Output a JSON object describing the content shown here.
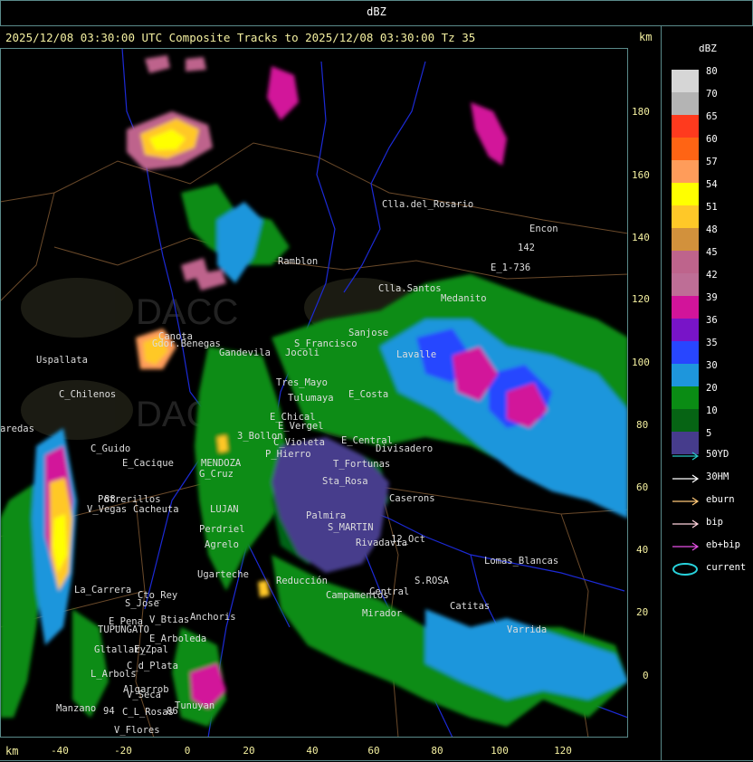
{
  "header": {
    "title": "dBZ",
    "subtitle": "2025/12/08 03:30:00 UTC Composite Tracks to 2025/12/08 03:30:00 Tz 35",
    "unit_label": "km"
  },
  "axes": {
    "x_ticks": [
      "-40",
      "-20",
      "0",
      "20",
      "40",
      "60",
      "80",
      "100",
      "120"
    ],
    "y_ticks": [
      "180",
      "160",
      "140",
      "120",
      "100",
      "80",
      "60",
      "40",
      "20",
      "0"
    ],
    "x_unit": "km",
    "y_unit": "km"
  },
  "legend": {
    "title": "dBZ",
    "levels": [
      {
        "value": "80",
        "color": "#d6d6d6"
      },
      {
        "value": "70",
        "color": "#b4b4b4"
      },
      {
        "value": "65",
        "color": "#ff3a1e"
      },
      {
        "value": "60",
        "color": "#ff6414"
      },
      {
        "value": "57",
        "color": "#ff9c5a"
      },
      {
        "value": "54",
        "color": "#ffff00"
      },
      {
        "value": "51",
        "color": "#ffc828"
      },
      {
        "value": "48",
        "color": "#d2913c"
      },
      {
        "value": "45",
        "color": "#be648c"
      },
      {
        "value": "42",
        "color": "#be6e96"
      },
      {
        "value": "39",
        "color": "#d2149a"
      },
      {
        "value": "36",
        "color": "#7814c8"
      },
      {
        "value": "35",
        "color": "#2846ff"
      },
      {
        "value": "30",
        "color": "#1e96dc"
      },
      {
        "value": "20",
        "color": "#0a8c14"
      },
      {
        "value": "10",
        "color": "#066414"
      },
      {
        "value": "5",
        "color": "#463c8c"
      }
    ],
    "tracks": [
      {
        "label": "50YD",
        "color": "#28c8c8"
      },
      {
        "label": "30HM",
        "color": "#ffffff"
      },
      {
        "label": "eburn",
        "color": "#ffc878"
      },
      {
        "label": "bip",
        "color": "#ffd2dc"
      },
      {
        "label": "eb+bip",
        "color": "#e650e6"
      },
      {
        "label": "current",
        "color": "#28d2dc"
      }
    ]
  },
  "places": [
    {
      "name": "Clla.del_Rosario"
    },
    {
      "name": "Encon"
    },
    {
      "name": "142"
    },
    {
      "name": "E_1-736"
    },
    {
      "name": "Ramblon"
    },
    {
      "name": "Clla.Santos"
    },
    {
      "name": "Medanito"
    },
    {
      "name": "Uspallata"
    },
    {
      "name": "Canota"
    },
    {
      "name": "Gdor.Benegas"
    },
    {
      "name": "Gandevila"
    },
    {
      "name": "S_Francisco"
    },
    {
      "name": "Jocoli"
    },
    {
      "name": "Sanjose"
    },
    {
      "name": "Lavalle"
    },
    {
      "name": "C_Chilenos"
    },
    {
      "name": "Tres_Mayo"
    },
    {
      "name": "Tulumaya"
    },
    {
      "name": "E_Costa"
    },
    {
      "name": "aredas"
    },
    {
      "name": "E_Chical"
    },
    {
      "name": "E_Vergel"
    },
    {
      "name": "3_Bollon"
    },
    {
      "name": "C_Violeta"
    },
    {
      "name": "E_Central"
    },
    {
      "name": "Divisadero"
    },
    {
      "name": "C_Guido"
    },
    {
      "name": "P_Hierro"
    },
    {
      "name": "E_Cacique"
    },
    {
      "name": "MENDOZA"
    },
    {
      "name": "G_Cruz"
    },
    {
      "name": "T_Fortunas"
    },
    {
      "name": "Sta_Rosa"
    },
    {
      "name": "Caserons"
    },
    {
      "name": "Potrerillos"
    },
    {
      "name": "V_Vegas"
    },
    {
      "name": "Cacheuta"
    },
    {
      "name": "Perdriel"
    },
    {
      "name": "LUJAN"
    },
    {
      "name": "Palmira"
    },
    {
      "name": "S_MARTIN"
    },
    {
      "name": "Agrelo"
    },
    {
      "name": "Ugarteche"
    },
    {
      "name": "Rivadavia"
    },
    {
      "name": "12_Oct"
    },
    {
      "name": "Lomas_Blancas"
    },
    {
      "name": "La_Carrera"
    },
    {
      "name": "Cto_Rey"
    },
    {
      "name": "S_Jose"
    },
    {
      "name": "Reducción"
    },
    {
      "name": "Campamentos"
    },
    {
      "name": "Central"
    },
    {
      "name": "S.ROSA"
    },
    {
      "name": "Catitas"
    },
    {
      "name": "E_Pena"
    },
    {
      "name": "V_Btias"
    },
    {
      "name": "TUPUNGATO"
    },
    {
      "name": "Anchoris"
    },
    {
      "name": "Mirador"
    },
    {
      "name": "Varrida"
    },
    {
      "name": "E_Arboleda"
    },
    {
      "name": "Gltallary"
    },
    {
      "name": "E_Zpal"
    },
    {
      "name": "L_Arbols"
    },
    {
      "name": "C_d_Plata"
    },
    {
      "name": "Algarrob"
    },
    {
      "name": "V_Seca"
    },
    {
      "name": "Tunuyan"
    },
    {
      "name": "Manzano"
    },
    {
      "name": "C_L_Rosas"
    },
    {
      "name": "V_Flores"
    },
    {
      "name": "88"
    },
    {
      "name": "94"
    },
    {
      "name": "86"
    }
  ]
}
